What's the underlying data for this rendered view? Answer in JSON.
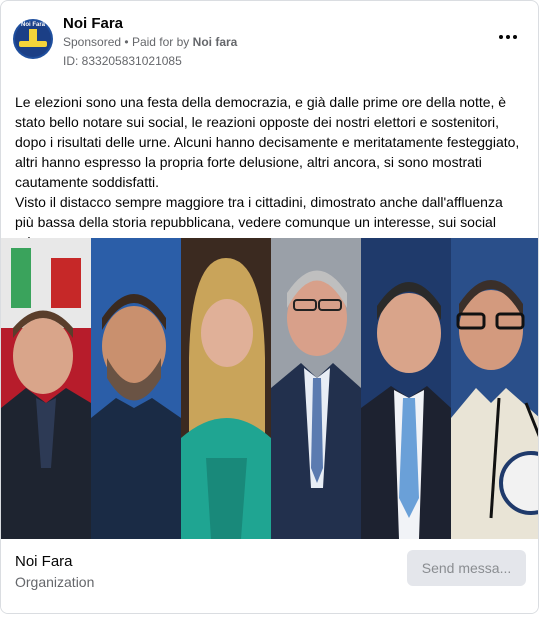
{
  "post": {
    "page_name": "Noi Fara",
    "avatar_text": "Noi Fara",
    "sponsored_label": "Sponsored",
    "separator": "•",
    "paid_prefix": "Paid for by",
    "paid_by": "Noi fara",
    "ad_id": "ID: 833205831021085",
    "more_icon": "more-options-icon",
    "body_lines": [
      "Le elezioni sono una festa della democrazia, e già dalle prime ore della notte, è",
      "stato bello notare sui social, le reazioni opposte dei nostri elettori e sostenitori,",
      "dopo i risultati delle urne. Alcuni hanno decisamente e meritatamente festeggiato,",
      "altri hanno espresso la propria forte delusione, altri ancora, si sono mostrati",
      "cautamente soddisfatti.",
      "Visto il distacco sempre maggiore tra i cittadini, dimostrato anche dall'affluenza",
      "più bassa della storia repubblicana, vedere comunque un interesse, sui social ed..."
    ]
  },
  "image": {
    "panels": 6
  },
  "footer": {
    "name": "Noi Fara",
    "category": "Organization",
    "send_button": "Send messa..."
  },
  "colors": {
    "secondary_text": "#65676b",
    "button_bg": "#e4e6eb",
    "border": "#dadde1"
  }
}
